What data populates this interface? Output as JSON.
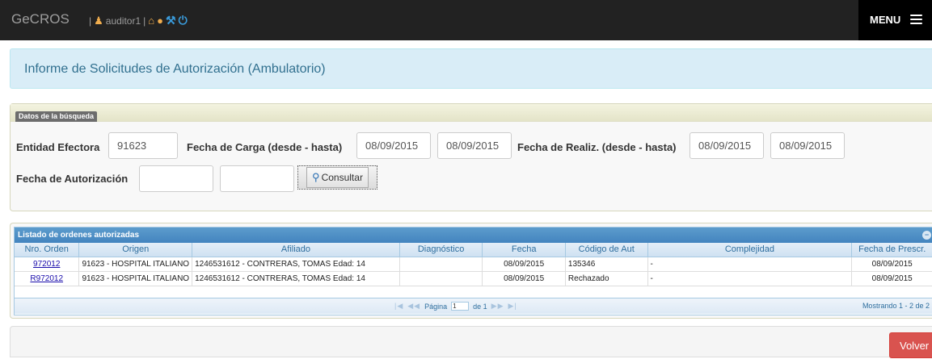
{
  "navbar": {
    "brand": "GeCROS",
    "separator": "|",
    "username": "auditor1",
    "menu_label": "MENU",
    "icons": [
      "user-icon",
      "home-icon",
      "lightbulb-icon",
      "wrench-icon",
      "power-icon"
    ]
  },
  "page": {
    "title": "Informe de Solicitudes de Autorización (Ambulatorio)"
  },
  "search": {
    "legend": "Datos de la búsqueda",
    "entidad_label": "Entidad Efectora",
    "entidad_value": "91623",
    "fecha_carga_label": "Fecha de Carga (desde - hasta)",
    "fecha_carga_desde": "08/09/2015",
    "fecha_carga_hasta": "08/09/2015",
    "fecha_realiz_label": "Fecha de Realiz. (desde - hasta)",
    "fecha_realiz_desde": "08/09/2015",
    "fecha_realiz_hasta": "08/09/2015",
    "fecha_autorizacion_label": "Fecha de Autorización",
    "fecha_autorizacion_desde": "",
    "fecha_autorizacion_hasta": "",
    "consultar_label": "Consultar"
  },
  "grid": {
    "caption": "Listado de ordenes autorizadas",
    "columns": [
      "Nro. Orden",
      "Origen",
      "Afiliado",
      "Diagnóstico",
      "Fecha",
      "Código de Aut",
      "Complejidad",
      "Fecha de Prescr."
    ],
    "rows": [
      {
        "nro_orden": "972012",
        "origen": "91623 - HOSPITAL ITALIANO",
        "afiliado": "1246531612 - CONTRERAS, TOMAS Edad: 14",
        "diagnostico": "",
        "fecha": "08/09/2015",
        "codigo": "135346",
        "complejidad": "-",
        "fecha_prescr": "08/09/2015"
      },
      {
        "nro_orden": "R972012",
        "origen": "91623 - HOSPITAL ITALIANO",
        "afiliado": "1246531612 - CONTRERAS, TOMAS Edad: 14",
        "diagnostico": "",
        "fecha": "08/09/2015",
        "codigo": "Rechazado",
        "complejidad": "-",
        "fecha_prescr": "08/09/2015"
      }
    ],
    "pager": {
      "page_label": "Página",
      "page_value": "1",
      "of_label": "de 1",
      "showing": "Mostrando 1 - 2 de 2"
    }
  },
  "footer": {
    "volver_label": "Volver"
  },
  "colors": {
    "navbar": "#222222",
    "title_bg": "#d9edf7",
    "title_text": "#31708f",
    "grid_header": "#4384bf",
    "volver": "#d9534f"
  }
}
